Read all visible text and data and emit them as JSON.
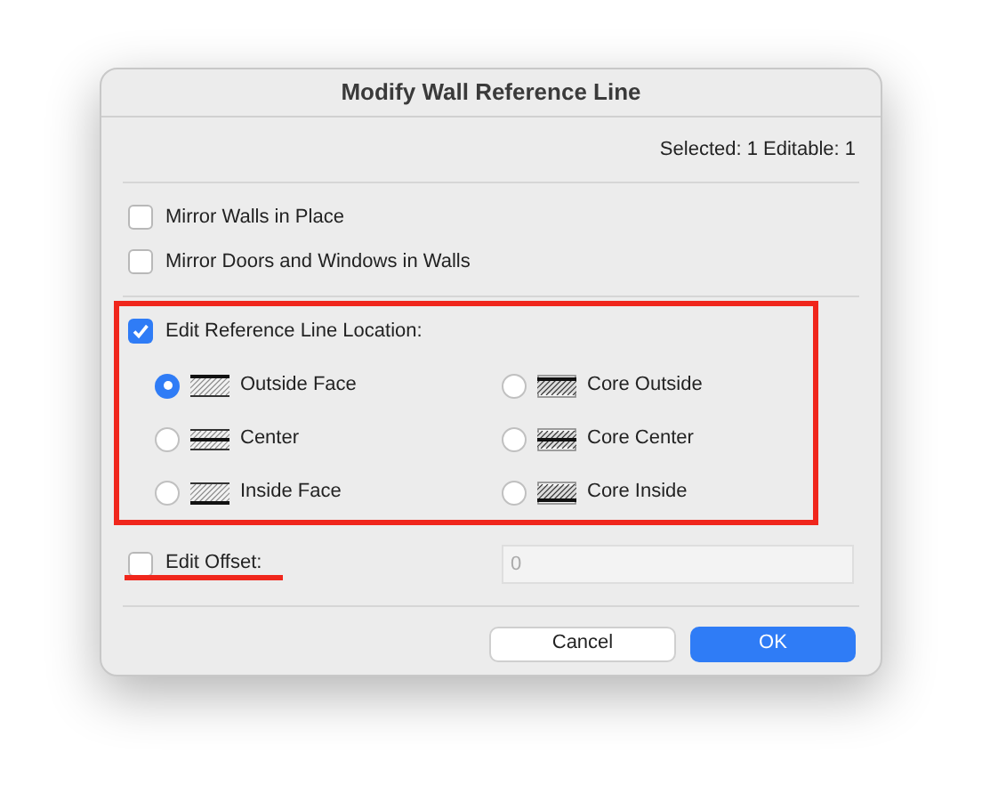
{
  "window": {
    "title": "Modify Wall Reference Line"
  },
  "selection_info": "Selected: 1 Editable: 1",
  "options": [
    {
      "label": "Mirror Walls in Place",
      "checked": false
    },
    {
      "label": "Mirror Doors and Windows in Walls",
      "checked": false
    }
  ],
  "reference_line": {
    "label": "Edit Reference Line Location:",
    "checked": true,
    "choices": [
      {
        "label": "Outside Face",
        "kind": "outside",
        "selected": true
      },
      {
        "label": "Core Outside",
        "kind": "core-outside",
        "selected": false
      },
      {
        "label": "Center",
        "kind": "center",
        "selected": false
      },
      {
        "label": "Core Center",
        "kind": "core-center",
        "selected": false
      },
      {
        "label": "Inside Face",
        "kind": "inside",
        "selected": false
      },
      {
        "label": "Core Inside",
        "kind": "core-inside",
        "selected": false
      }
    ]
  },
  "offset": {
    "label": "Edit Offset:",
    "checked": false,
    "placeholder": "0"
  },
  "buttons": [
    {
      "label": "Cancel",
      "kind": "secondary"
    },
    {
      "label": "OK",
      "kind": "primary"
    }
  ]
}
